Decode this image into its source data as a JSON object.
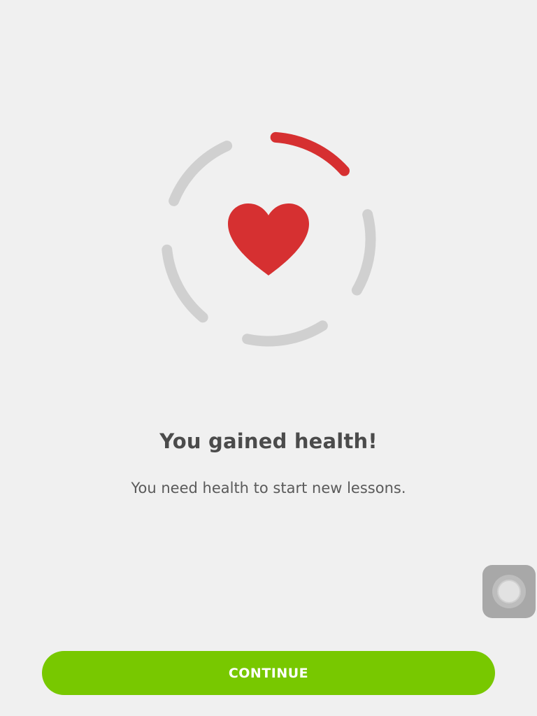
{
  "health": {
    "title": "You gained health!",
    "subtitle": "You need health to start new lessons.",
    "segments_total": 5,
    "segments_filled": 1,
    "icon": "heart-icon"
  },
  "actions": {
    "continue_label": "CONTINUE"
  },
  "overlay": {
    "icon": "assistive-touch-icon"
  },
  "colors": {
    "background": "#f0f0f0",
    "heart": "#d63031",
    "segment_filled": "#d63031",
    "segment_empty": "#d0d0d0",
    "button": "#78c800",
    "button_text": "#ffffff",
    "title_text": "#4b4b4b",
    "subtitle_text": "#5a5a5a"
  }
}
